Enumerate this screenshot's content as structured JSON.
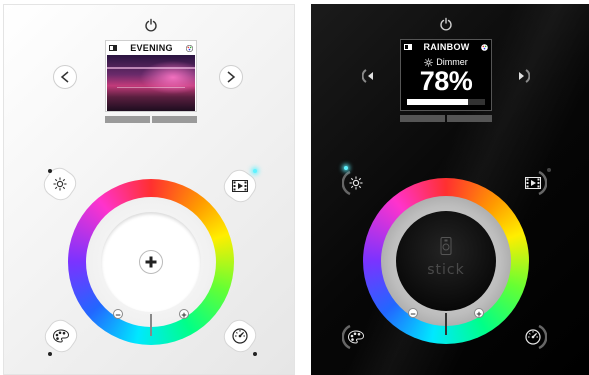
{
  "white_panel": {
    "screen": {
      "title": "EVENING"
    },
    "wheel": {
      "minus": "−",
      "plus": "+"
    }
  },
  "black_panel": {
    "screen": {
      "title": "RAINBOW",
      "dimmer_label": "Dimmer",
      "dimmer_value": "78%",
      "dimmer_level": 0.78
    },
    "wheel": {
      "minus": "−",
      "plus": "+",
      "logo_text": "stick"
    }
  },
  "colors": {
    "led_active": "#5ff3ff",
    "white_panel_bg": "#f1f1f1",
    "black_panel_bg": "#070707"
  },
  "icons": [
    "power-icon",
    "scene-icon",
    "palette-icon",
    "chevron-left-icon",
    "chevron-right-icon",
    "dimmer-icon",
    "film-icon",
    "color-palette-icon",
    "speed-icon",
    "plus-icon",
    "stick-logo-icon"
  ]
}
